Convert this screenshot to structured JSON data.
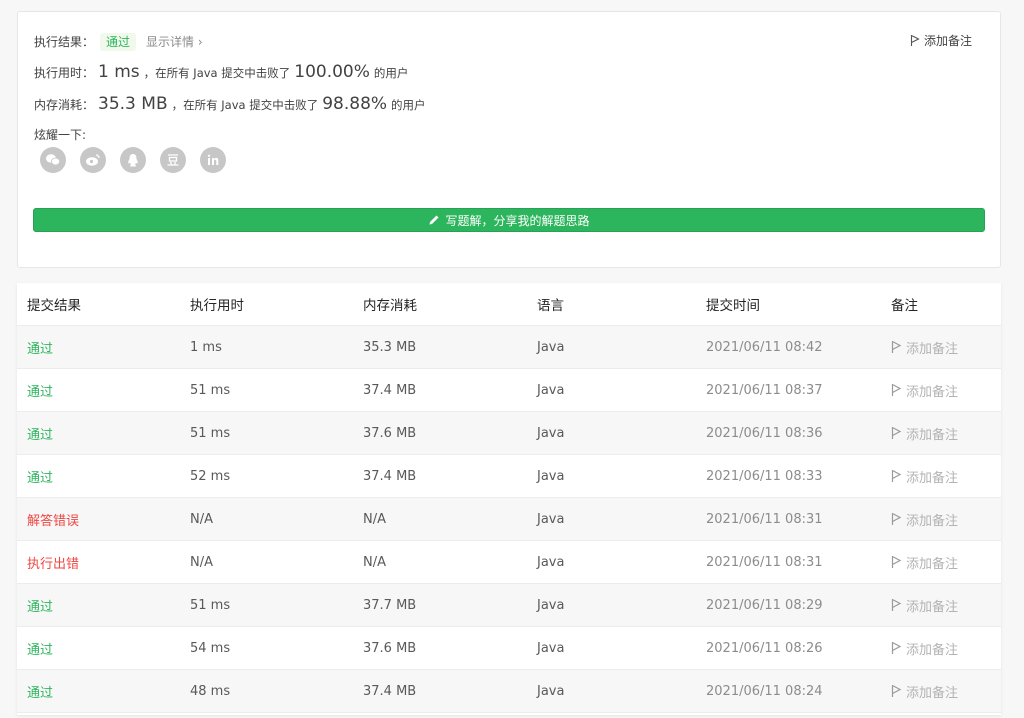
{
  "summary": {
    "result_label": "执行结果：",
    "result_status": "通过",
    "show_details": "显示详情",
    "runtime_label": "执行用时：",
    "runtime_value": "1 ms",
    "runtime_mid": "，在所有 Java 提交中击败了",
    "runtime_percent": "100.00%",
    "runtime_suffix": "的用户",
    "memory_label": "内存消耗：",
    "memory_value": "35.3 MB",
    "memory_mid": "，在所有 Java 提交中击败了",
    "memory_percent": "98.88%",
    "memory_suffix": "的用户",
    "share_label": "炫耀一下:",
    "share_icons": [
      "wechat-icon",
      "weibo-icon",
      "qq-icon",
      "douban-icon",
      "linkedin-icon"
    ],
    "add_note": "添加备注",
    "write_solution": "写题解，分享我的解题思路"
  },
  "table": {
    "headers": [
      "提交结果",
      "执行用时",
      "内存消耗",
      "语言",
      "提交时间",
      "备注"
    ],
    "rows": [
      {
        "status": "通过",
        "runtime": "1 ms",
        "memory": "35.3 MB",
        "language": "Java",
        "time": "2021/06/11 08:42",
        "note": "添加备注"
      },
      {
        "status": "通过",
        "runtime": "51 ms",
        "memory": "37.4 MB",
        "language": "Java",
        "time": "2021/06/11 08:37",
        "note": "添加备注"
      },
      {
        "status": "通过",
        "runtime": "51 ms",
        "memory": "37.6 MB",
        "language": "Java",
        "time": "2021/06/11 08:36",
        "note": "添加备注"
      },
      {
        "status": "通过",
        "runtime": "52 ms",
        "memory": "37.4 MB",
        "language": "Java",
        "time": "2021/06/11 08:33",
        "note": "添加备注"
      },
      {
        "status": "解答错误",
        "runtime": "N/A",
        "memory": "N/A",
        "language": "Java",
        "time": "2021/06/11 08:31",
        "note": "添加备注"
      },
      {
        "status": "执行出错",
        "runtime": "N/A",
        "memory": "N/A",
        "language": "Java",
        "time": "2021/06/11 08:31",
        "note": "添加备注"
      },
      {
        "status": "通过",
        "runtime": "51 ms",
        "memory": "37.7 MB",
        "language": "Java",
        "time": "2021/06/11 08:29",
        "note": "添加备注"
      },
      {
        "status": "通过",
        "runtime": "54 ms",
        "memory": "37.6 MB",
        "language": "Java",
        "time": "2021/06/11 08:26",
        "note": "添加备注"
      },
      {
        "status": "通过",
        "runtime": "48 ms",
        "memory": "37.4 MB",
        "language": "Java",
        "time": "2021/06/11 08:24",
        "note": "添加备注"
      }
    ]
  },
  "colors": {
    "accent": "#2db55d",
    "error": "#ef4743",
    "muted": "#8c8c8c"
  }
}
